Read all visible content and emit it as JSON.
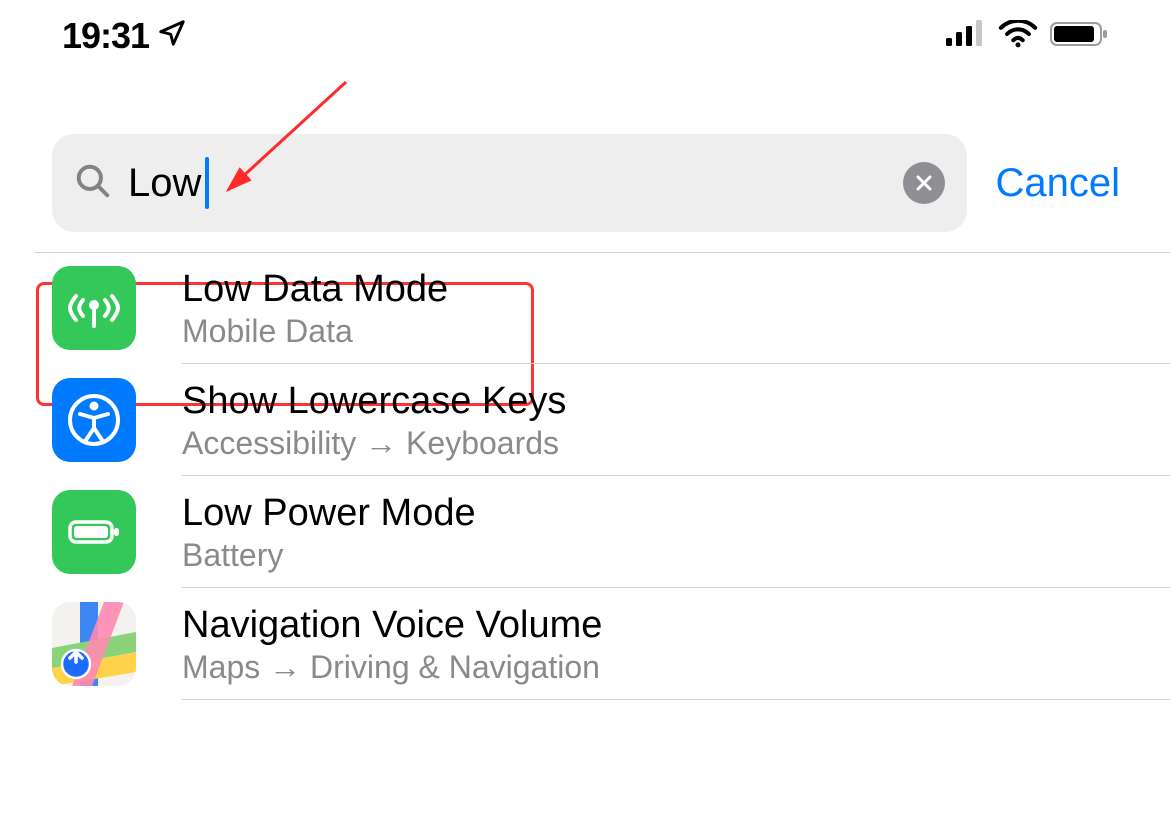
{
  "statusbar": {
    "time": "19:31"
  },
  "search": {
    "query": "Low",
    "cancel": "Cancel"
  },
  "results": [
    {
      "title": "Low Data Mode",
      "subtitle": "Mobile Data"
    },
    {
      "title": "Show Lowercase Keys",
      "subtitle": "Accessibility → Keyboards"
    },
    {
      "title": "Low Power Mode",
      "subtitle": "Battery"
    },
    {
      "title": "Navigation Voice Volume",
      "subtitle": "Maps → Driving & Navigation"
    }
  ]
}
